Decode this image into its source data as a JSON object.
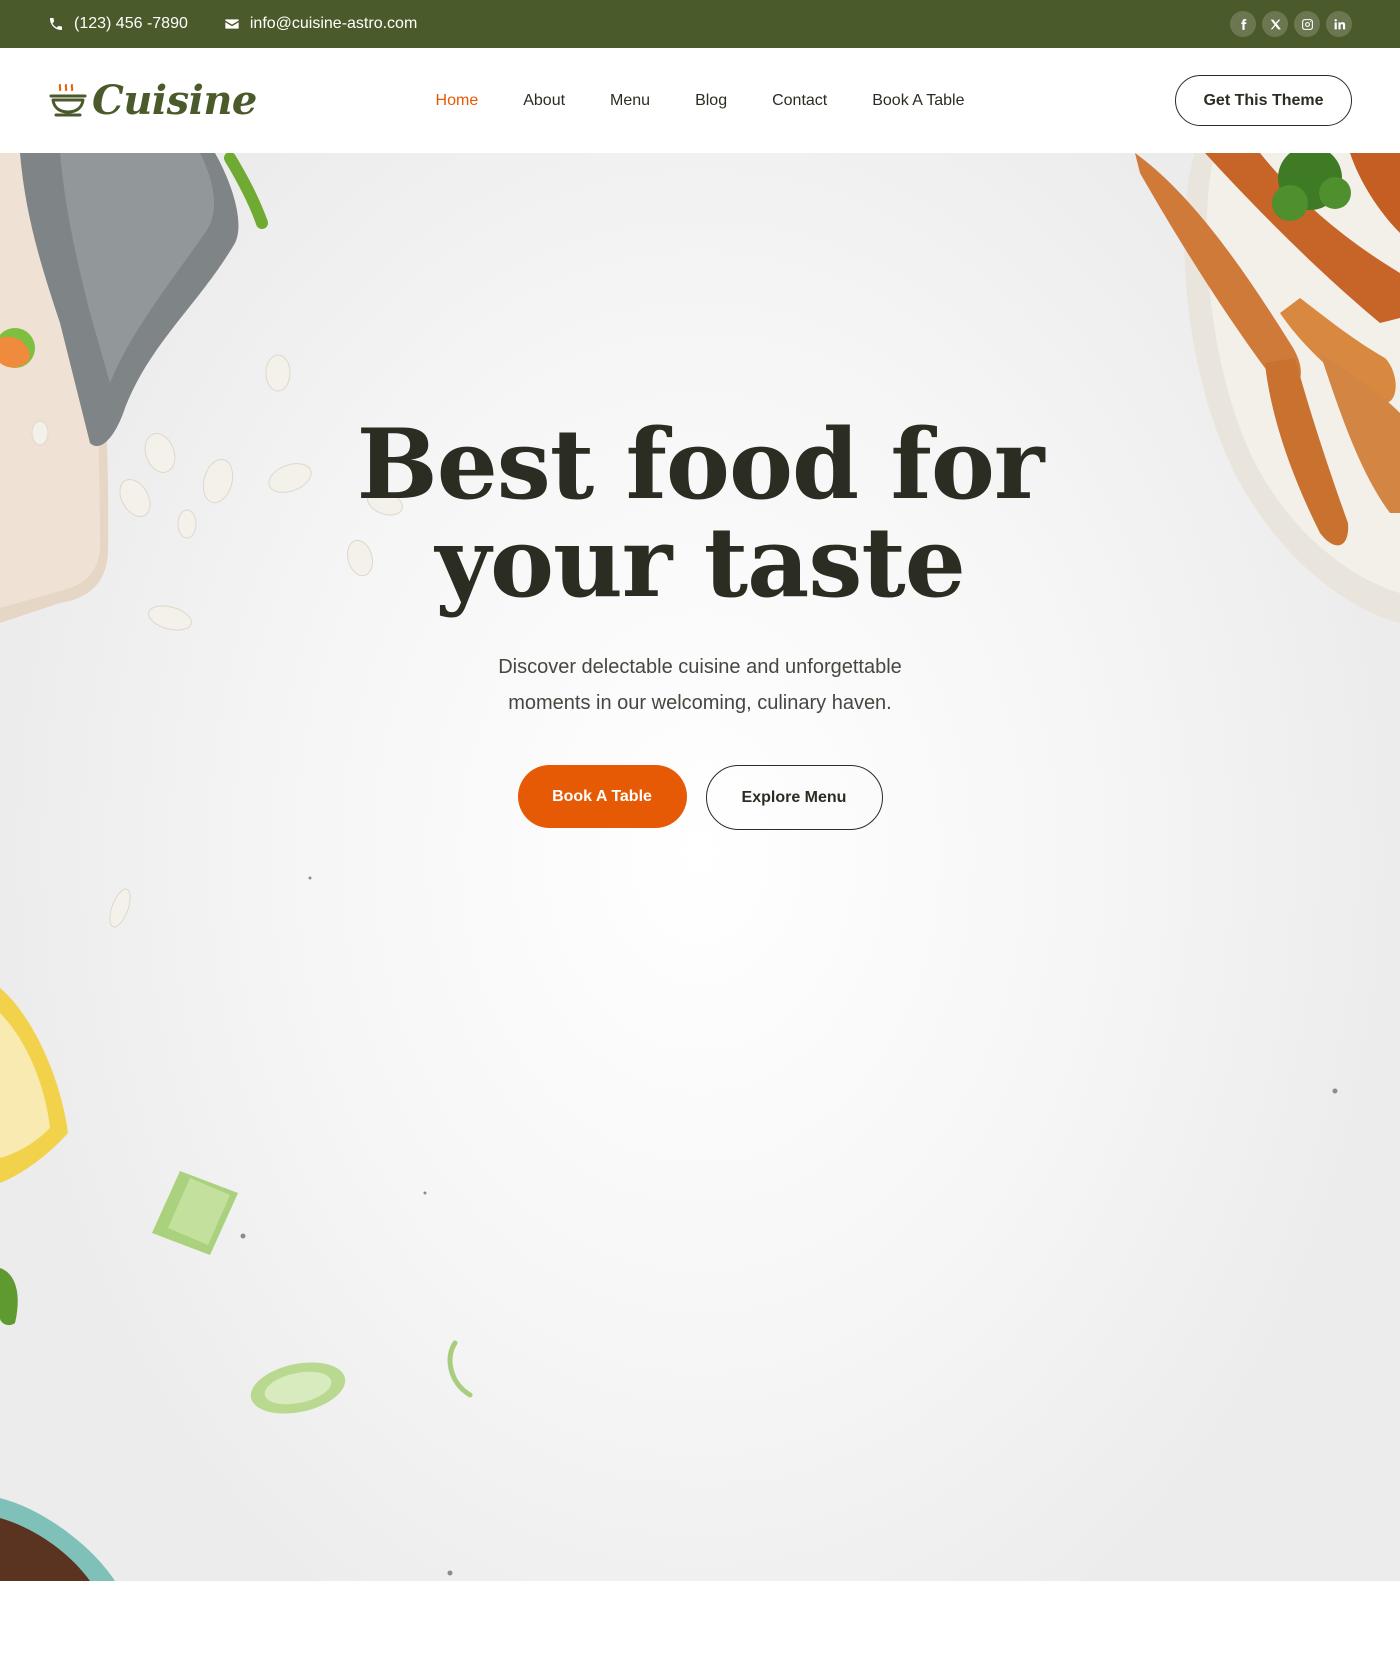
{
  "topbar": {
    "phone": "(123) 456 -7890",
    "email": "info@cuisine-astro.com",
    "socials": [
      "facebook-icon",
      "x-icon",
      "instagram-icon",
      "linkedin-icon"
    ]
  },
  "header": {
    "logo_text": "Cuisine",
    "nav": [
      "Home",
      "About",
      "Menu",
      "Blog",
      "Contact",
      "Book A Table"
    ],
    "active_nav": "Home",
    "cta_label": "Get This Theme"
  },
  "hero": {
    "title_line1": "Best food for",
    "title_line2": "your taste",
    "subtitle_line1": "Discover delectable cuisine and unforgettable",
    "subtitle_line2": "moments in our welcoming, culinary haven.",
    "primary_button": "Book A Table",
    "secondary_button": "Explore Menu"
  },
  "colors": {
    "brand_green": "#4a5a2b",
    "accent_orange": "#e65a05",
    "text_dark": "#2b2d22"
  }
}
